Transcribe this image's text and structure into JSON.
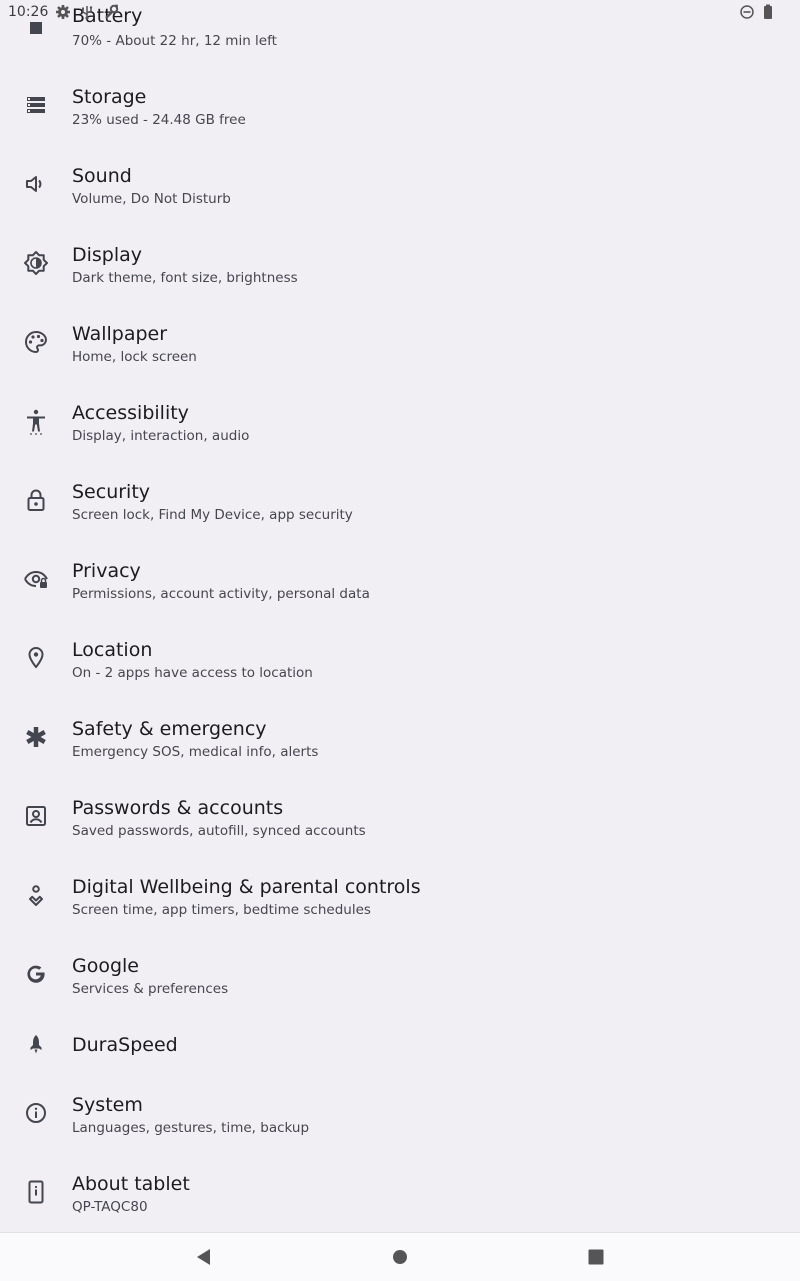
{
  "status_bar": {
    "time": "10:26",
    "left_icons": [
      "gear-icon",
      "usb-icon",
      "wrench-icon"
    ],
    "right_icons": [
      "do-not-disturb-icon",
      "battery-icon"
    ]
  },
  "settings": [
    {
      "id": "battery",
      "icon": "battery-icon",
      "title": "Battery",
      "subtitle": "70% - About 22 hr, 12 min left"
    },
    {
      "id": "storage",
      "icon": "storage-icon",
      "title": "Storage",
      "subtitle": "23% used - 24.48 GB free"
    },
    {
      "id": "sound",
      "icon": "volume-icon",
      "title": "Sound",
      "subtitle": "Volume, Do Not Disturb"
    },
    {
      "id": "display",
      "icon": "brightness-icon",
      "title": "Display",
      "subtitle": "Dark theme, font size, brightness"
    },
    {
      "id": "wallpaper",
      "icon": "palette-icon",
      "title": "Wallpaper",
      "subtitle": "Home, lock screen"
    },
    {
      "id": "accessibility",
      "icon": "accessibility-icon",
      "title": "Accessibility",
      "subtitle": "Display, interaction, audio"
    },
    {
      "id": "security",
      "icon": "lock-icon",
      "title": "Security",
      "subtitle": "Screen lock, Find My Device, app security"
    },
    {
      "id": "privacy",
      "icon": "eye-lock-icon",
      "title": "Privacy",
      "subtitle": "Permissions, account activity, personal data"
    },
    {
      "id": "location",
      "icon": "location-pin-icon",
      "title": "Location",
      "subtitle": "On - 2 apps have access to location"
    },
    {
      "id": "safety",
      "icon": "asterisk-icon",
      "title": "Safety & emergency",
      "subtitle": "Emergency SOS, medical info, alerts"
    },
    {
      "id": "passwords",
      "icon": "account-box-icon",
      "title": "Passwords & accounts",
      "subtitle": "Saved passwords, autofill, synced accounts"
    },
    {
      "id": "wellbeing",
      "icon": "wellbeing-icon",
      "title": "Digital Wellbeing & parental controls",
      "subtitle": "Screen time, app timers, bedtime schedules"
    },
    {
      "id": "google",
      "icon": "google-icon",
      "title": "Google",
      "subtitle": "Services & preferences"
    },
    {
      "id": "duraspeed",
      "icon": "rocket-icon",
      "title": "DuraSpeed",
      "subtitle": ""
    },
    {
      "id": "system",
      "icon": "info-icon",
      "title": "System",
      "subtitle": "Languages, gestures, time, backup"
    },
    {
      "id": "about",
      "icon": "tablet-icon",
      "title": "About tablet",
      "subtitle": "QP-TAQC80"
    }
  ],
  "nav_bar": {
    "back": "back-icon",
    "home": "home-icon",
    "recents": "recents-icon"
  },
  "colors": {
    "background": "#f2eff4",
    "icon": "#44464f",
    "title": "#1c1b1f",
    "subtitle": "#46464f"
  }
}
